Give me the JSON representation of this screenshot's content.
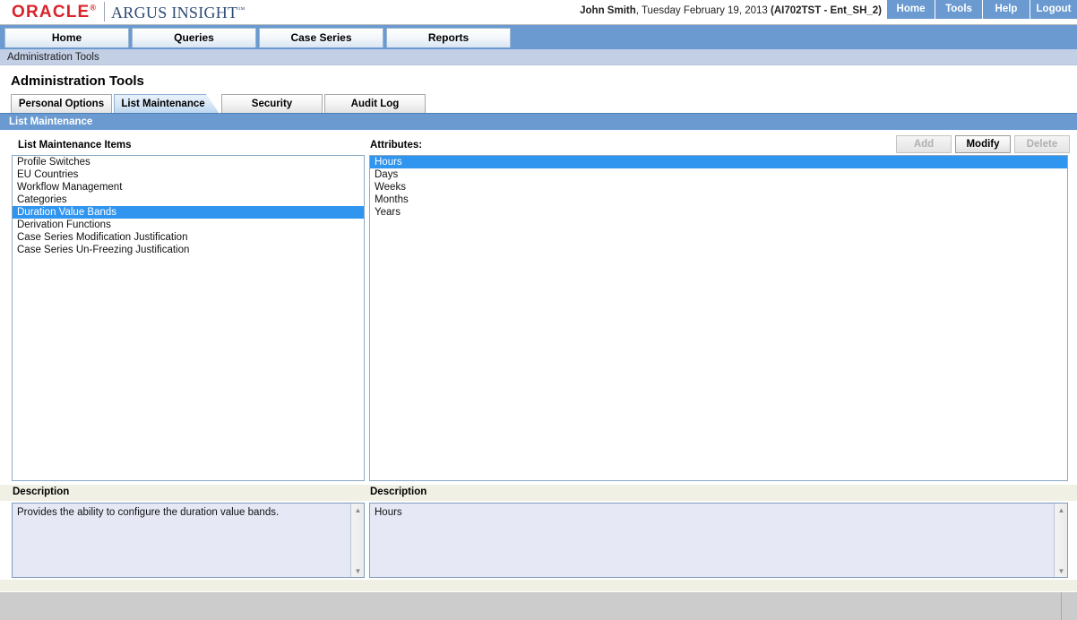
{
  "branding": {
    "oracle": "ORACLE",
    "oracle_mark": "®",
    "product": "ARGUS INSIGHT",
    "product_mark": "™"
  },
  "header": {
    "user_name": "John Smith",
    "user_separator": ", ",
    "date": "Tuesday February 19, 2013",
    "tenant": "(AI702TST - Ent_SH_2)",
    "links": [
      {
        "label": "Home",
        "name": "header-link-home"
      },
      {
        "label": "Tools",
        "name": "header-link-tools"
      },
      {
        "label": "Help",
        "name": "header-link-help"
      },
      {
        "label": "Logout",
        "name": "header-link-logout"
      }
    ]
  },
  "main_nav": {
    "tabs": [
      {
        "label": "Home"
      },
      {
        "label": "Queries"
      },
      {
        "label": "Case Series"
      },
      {
        "label": "Reports"
      }
    ]
  },
  "breadcrumb": {
    "text": "Administration Tools"
  },
  "page": {
    "title": "Administration Tools",
    "section_title": "List Maintenance"
  },
  "subtabs": [
    {
      "label": "Personal Options",
      "active": false
    },
    {
      "label": "List Maintenance",
      "active": true
    },
    {
      "label": "Security",
      "active": false
    },
    {
      "label": "Audit Log",
      "active": false
    }
  ],
  "list_maintenance": {
    "header": "List Maintenance Items",
    "items": [
      {
        "label": "Profile Switches",
        "selected": false
      },
      {
        "label": "EU Countries",
        "selected": false
      },
      {
        "label": "Workflow Management",
        "selected": false
      },
      {
        "label": "Categories",
        "selected": false
      },
      {
        "label": "Duration Value Bands",
        "selected": true
      },
      {
        "label": "Derivation Functions",
        "selected": false
      },
      {
        "label": "Case Series Modification Justification",
        "selected": false
      },
      {
        "label": "Case Series Un-Freezing Justification",
        "selected": false
      }
    ],
    "description_label": "Description",
    "description_text": "Provides the ability to configure the duration value bands."
  },
  "attributes": {
    "header": "Attributes:",
    "items": [
      {
        "label": "Hours",
        "selected": true
      },
      {
        "label": "Days",
        "selected": false
      },
      {
        "label": "Weeks",
        "selected": false
      },
      {
        "label": "Months",
        "selected": false
      },
      {
        "label": "Years",
        "selected": false
      }
    ],
    "description_label": "Description",
    "description_text": "Hours"
  },
  "action_buttons": [
    {
      "label": "Add",
      "enabled": false,
      "name": "add-button"
    },
    {
      "label": "Modify",
      "enabled": true,
      "name": "modify-button"
    },
    {
      "label": "Delete",
      "enabled": false,
      "name": "delete-button"
    }
  ],
  "colors": {
    "nav_blue": "#6a9ad0",
    "breadcrumb_blue": "#c3cfe5",
    "selection_blue": "#2f95ef",
    "oracle_red": "#d8232a",
    "product_navy": "#2e4b74",
    "band_cream": "#f0f0e4",
    "desc_field": "#e7e8f5",
    "status_gray": "#cccccc"
  }
}
